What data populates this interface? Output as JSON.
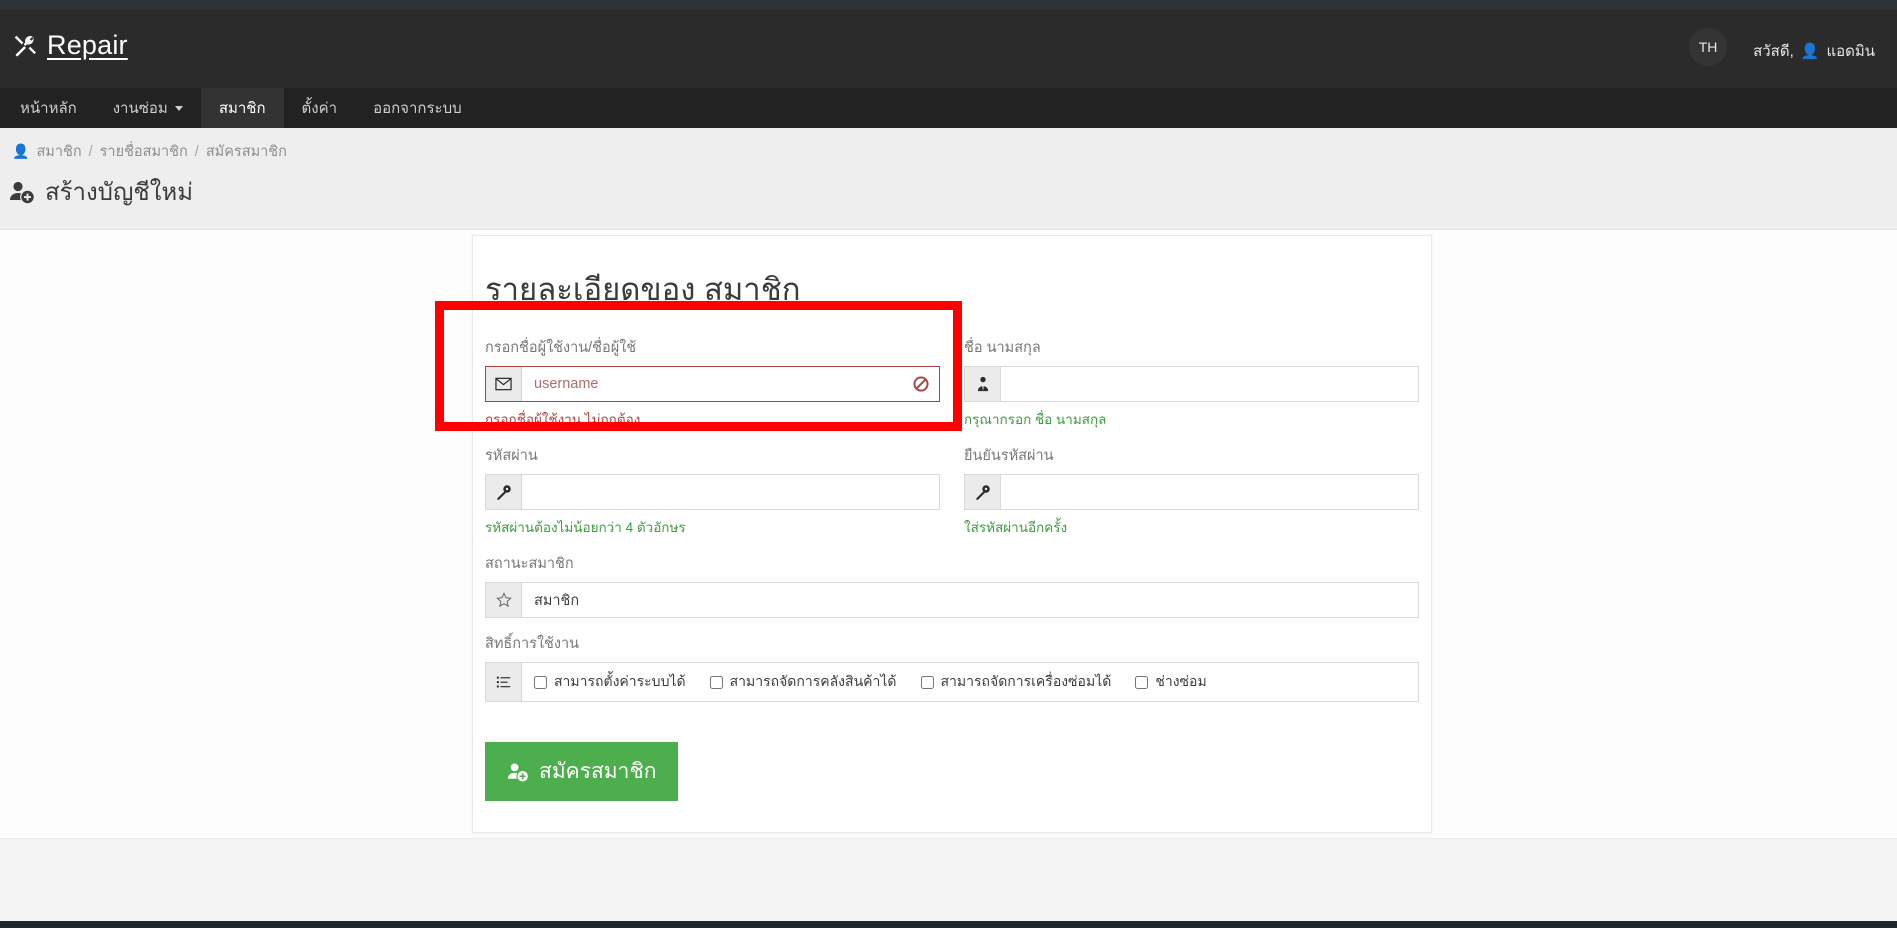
{
  "header": {
    "brand": "Repair",
    "brand_icon": "wrench-screwdriver-icon",
    "lang_badge": "TH",
    "greeting_prefix": "สวัสดี,",
    "user_icon": "user-icon",
    "user_name": "แอดมิน"
  },
  "nav": {
    "items": [
      {
        "label": "หน้าหลัก",
        "active": false,
        "caret": false
      },
      {
        "label": "งานซ่อม",
        "active": false,
        "caret": true
      },
      {
        "label": "สมาชิก",
        "active": true,
        "caret": false
      },
      {
        "label": "ตั้งค่า",
        "active": false,
        "caret": false
      },
      {
        "label": "ออกจากระบบ",
        "active": false,
        "caret": false
      }
    ]
  },
  "breadcrumb": {
    "icon": "user-icon",
    "items": [
      "สมาชิก",
      "รายชื่อสมาชิก",
      "สมัครสมาชิก"
    ],
    "separator": "/"
  },
  "page": {
    "title": "สร้างบัญชีใหม่",
    "title_icon": "user-plus-icon"
  },
  "card": {
    "title": "รายละเอียดของ สมาชิก"
  },
  "form": {
    "username": {
      "label": "กรอกชื่อผู้ใช้งาน/ชื่อผู้ใช้",
      "icon": "envelope-icon",
      "placeholder": "username",
      "value": "",
      "state_icon": "ban-icon",
      "help": "กรอกชื่อผู้ใช้งาน ไม่ถูกต้อง",
      "help_state": "error"
    },
    "fullname": {
      "label": "ชื่อ นามสกุล",
      "icon": "user-tie-icon",
      "placeholder": "",
      "value": "",
      "help": "กรุณากรอก ชื่อ นามสกุล",
      "help_state": "ok"
    },
    "password": {
      "label": "รหัสผ่าน",
      "icon": "key-icon",
      "placeholder": "",
      "value": "",
      "help": "รหัสผ่านต้องไม่น้อยกว่า 4 ตัวอักษร",
      "help_state": "ok"
    },
    "confirm_password": {
      "label": "ยืนยันรหัสผ่าน",
      "icon": "key-icon",
      "placeholder": "",
      "value": "",
      "help": "ใส่รหัสผ่านอีกครั้ง",
      "help_state": "ok"
    },
    "status": {
      "label": "สถานะสมาชิก",
      "icon": "star-icon",
      "value": "สมาชิก",
      "placeholder": ""
    },
    "permissions": {
      "label": "สิทธิ์การใช้งาน",
      "icon": "list-check-icon",
      "options": [
        {
          "label": "สามารถตั้งค่าระบบได้",
          "checked": false
        },
        {
          "label": "สามารถจัดการคลังสินค้าได้",
          "checked": false
        },
        {
          "label": "สามารถจัดการเครื่องซ่อมได้",
          "checked": false
        },
        {
          "label": "ช่างซ่อม",
          "checked": false
        }
      ]
    },
    "submit": {
      "label": "สมัครสมาชิก",
      "icon": "user-plus-icon"
    }
  },
  "colors": {
    "header_bg": "#2b2b2b",
    "nav_bg": "#222222",
    "nav_active_bg": "#333333",
    "band_bg": "#eeeeee",
    "submit_green": "#4cae4c",
    "help_green": "#3c9d3c",
    "error_red": "#a94442",
    "annotation_red": "#fe0000"
  }
}
